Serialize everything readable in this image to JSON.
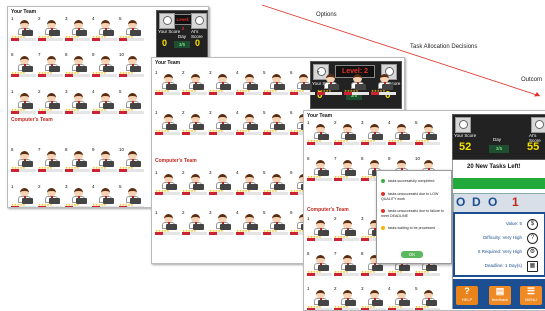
{
  "annotations": {
    "options": "Options",
    "task_allocation": "Task Allocation Decisions",
    "outcome": "Outcom"
  },
  "panels": [
    {
      "your_team": "Your Team",
      "computer_team": "Computer's Team",
      "level": "Level: 2",
      "your_score_label": "Your Score",
      "ai_score_label": "AI's Score",
      "day_label": "Day",
      "day_value": "3/5",
      "your_score": "0",
      "ai_score": "0"
    },
    {
      "your_team": "Your Team",
      "computer_team": "Computer's Team",
      "level": "Level: 2",
      "your_score_label": "Your Score",
      "ai_score_label": "AI's Score",
      "day_label": "Day",
      "day_value": "3/5",
      "your_score": "0",
      "ai_score": "0"
    },
    {
      "your_team": "Your Team",
      "computer_team": "Computer's Team",
      "level": "Level: 2",
      "your_score_label": "Your Score",
      "ai_score_label": "AI's Score",
      "day_label": "Day",
      "day_value": "3/5",
      "your_score": "52",
      "ai_score": "55"
    }
  ],
  "worker_numbers": [
    "1",
    "2",
    "3",
    "4",
    "5",
    "6",
    "7",
    "8",
    "9",
    "10"
  ],
  "worker_caption": "Workload",
  "dialog": {
    "items": [
      {
        "text": "tasks successfully completed",
        "color": "#3cb043"
      },
      {
        "text": "tasks unsuccessful due to LOW QUALITY work",
        "color": "#e0332b"
      },
      {
        "text": "tasks unsuccessful due to failure to meet DEADLINE",
        "color": "#e0332b"
      },
      {
        "text": "tasks waiting to be processed",
        "color": "#f2b705"
      }
    ],
    "ok_label": "OK"
  },
  "task_panel": {
    "new_tasks": "20 New Tasks Left!",
    "todo_letters": [
      "O",
      "D",
      "O"
    ],
    "todo_count": "1",
    "value": "Value: 5",
    "difficulty": "Difficulty: Very High",
    "effort": "rt Required: Very High",
    "deadline": "Deadline: 1 Day(s)",
    "help_label": "HELP",
    "feedback_label": "feedback",
    "menu_label": "MENU"
  },
  "colors": {
    "level_red": "#e8312a",
    "score_yellow": "#f7e100",
    "task_blue": "#1b4f91",
    "task_green": "#22a93c",
    "help_orange": "#e8841a",
    "feedback_orange": "#f08a24",
    "menu_orange": "#f08a24"
  }
}
